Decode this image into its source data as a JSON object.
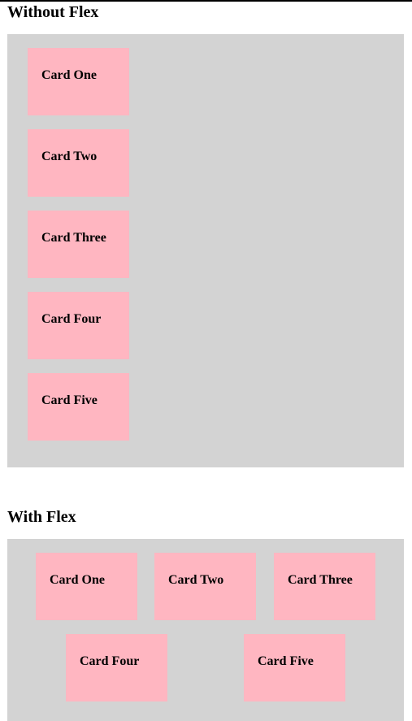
{
  "sections": [
    {
      "title": "Without Flex",
      "cards": [
        "Card One",
        "Card Two",
        "Card Three",
        "Card Four",
        "Card Five"
      ]
    },
    {
      "title": "With Flex",
      "cards": [
        "Card One",
        "Card Two",
        "Card Three",
        "Card Four",
        "Card Five"
      ]
    }
  ],
  "colors": {
    "container_bg": "#d3d3d3",
    "card_bg": "#ffb6c1",
    "page_bg": "#ffffff",
    "text": "#000000"
  }
}
